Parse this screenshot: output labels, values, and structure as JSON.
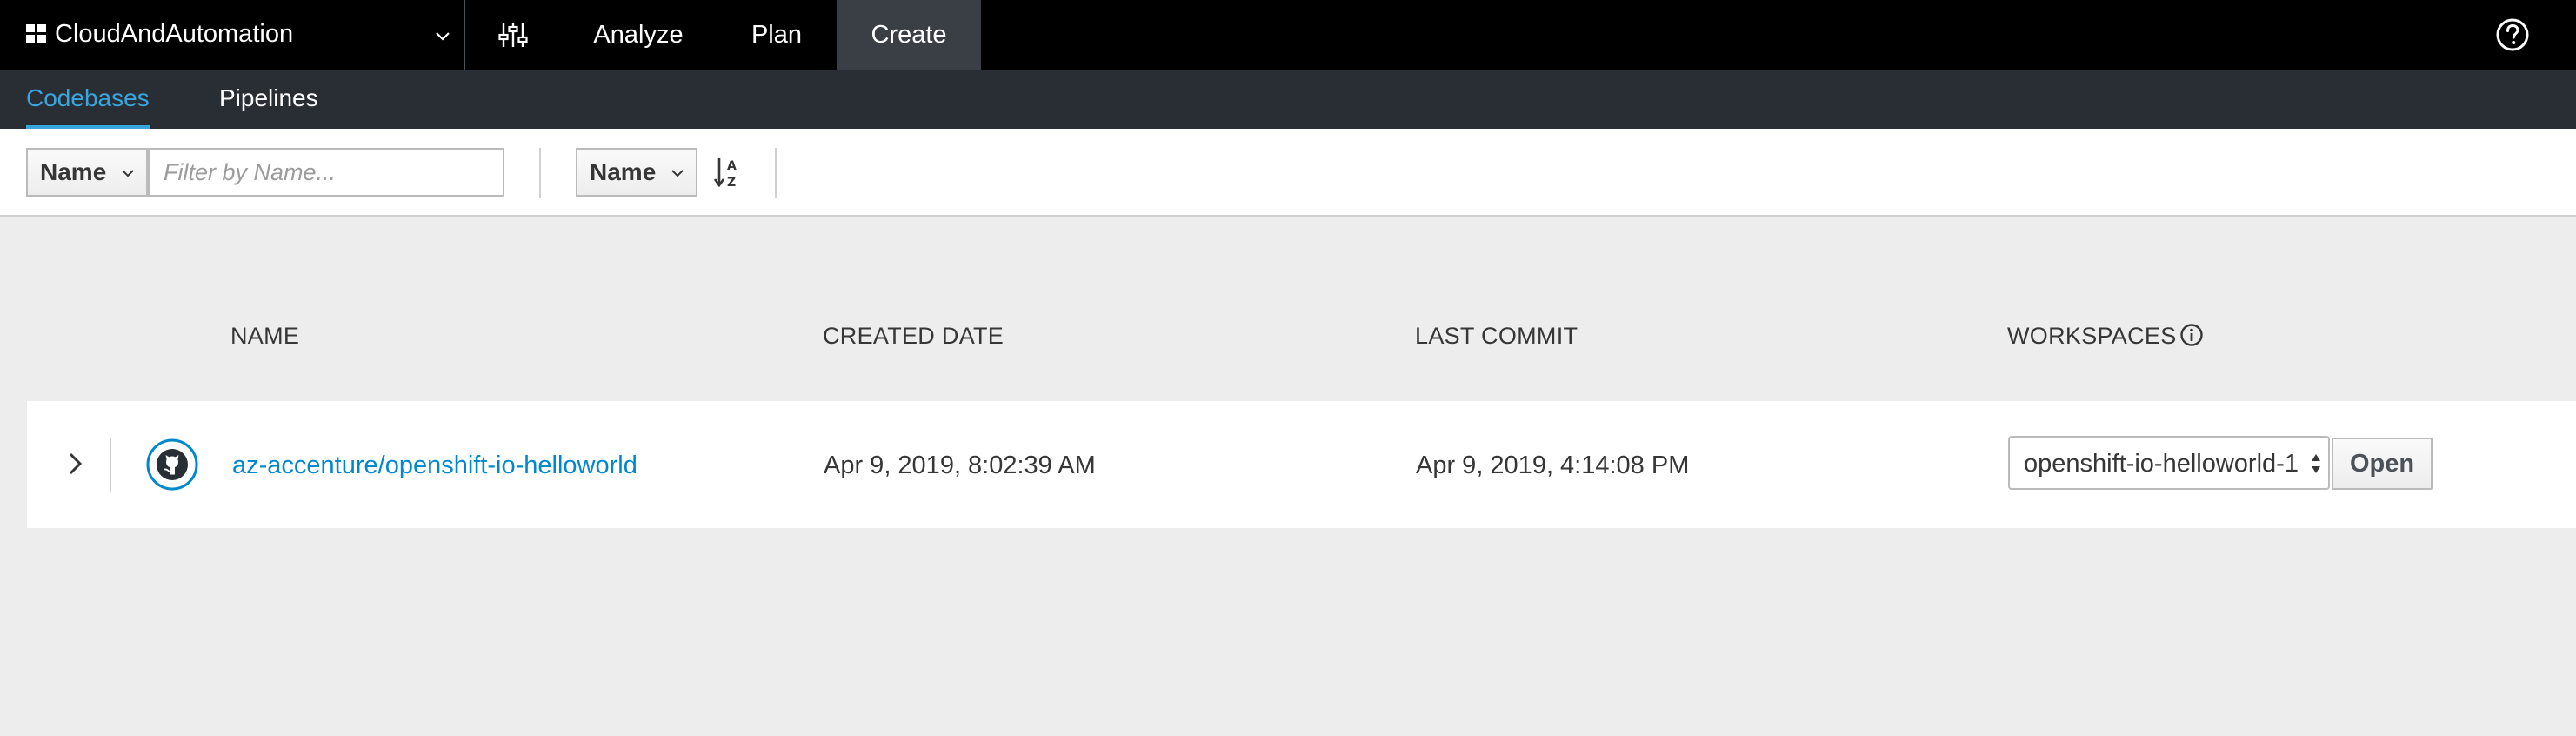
{
  "topbar": {
    "space_name": "CloudAndAutomation",
    "space_icon": "grid-icon",
    "settings_icon": "sliders-icon",
    "nav": [
      {
        "label": "Analyze"
      },
      {
        "label": "Plan"
      },
      {
        "label": "Create",
        "active": true
      }
    ],
    "help_icon": "question-circle-icon",
    "background": "#000000",
    "active_background": "#393f44"
  },
  "subnav": {
    "tabs": [
      {
        "label": "Codebases",
        "active": true
      },
      {
        "label": "Pipelines"
      }
    ],
    "accent": "#39a5dc",
    "background": "#292e34"
  },
  "toolbar": {
    "filter_field": "Name",
    "filter_placeholder": "Filter by Name...",
    "sort_field": "Name",
    "sort_icon": "sort-alpha-asc-icon"
  },
  "table": {
    "columns": [
      "NAME",
      "CREATED DATE",
      "LAST COMMIT",
      "WORKSPACES"
    ],
    "workspaces_info_icon": "info-circle-icon",
    "rows": [
      {
        "repo_icon": "github-icon",
        "name": "az-accenture/openshift-io-helloworld",
        "created_date": "Apr 9, 2019, 8:02:39 AM",
        "last_commit": "Apr 9, 2019, 4:14:08 PM",
        "workspace": "openshift-io-helloworld-1",
        "open_label": "Open"
      }
    ],
    "link_color": "#0088ce"
  }
}
